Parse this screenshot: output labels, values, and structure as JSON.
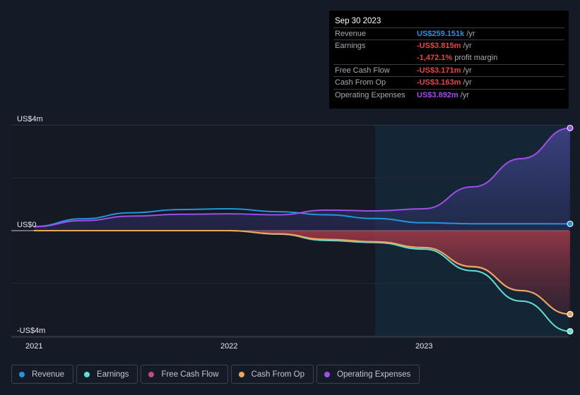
{
  "tooltip": {
    "date": "Sep 30 2023",
    "rows": [
      {
        "label": "Revenue",
        "value": "US$259.151k",
        "unit": "/yr",
        "color": "#2394df"
      },
      {
        "label": "Earnings",
        "value": "-US$3.815m",
        "unit": "/yr",
        "color": "#e64646"
      },
      {
        "label": "",
        "value": "-1,472.1%",
        "unit": "profit margin",
        "color": "#e64646"
      },
      {
        "label": "Free Cash Flow",
        "value": "-US$3.171m",
        "unit": "/yr",
        "color": "#e64646"
      },
      {
        "label": "Cash From Op",
        "value": "-US$3.163m",
        "unit": "/yr",
        "color": "#e64646"
      },
      {
        "label": "Operating Expenses",
        "value": "US$3.892m",
        "unit": "/yr",
        "color": "#a04ee8"
      }
    ]
  },
  "chart_data": {
    "type": "line",
    "x": [
      2021.0,
      2021.25,
      2021.5,
      2021.75,
      2022.0,
      2022.25,
      2022.5,
      2022.75,
      2023.0,
      2023.25,
      2023.5,
      2023.75
    ],
    "xticks": [
      {
        "v": 2021,
        "label": "2021"
      },
      {
        "v": 2022,
        "label": "2022"
      },
      {
        "v": 2023,
        "label": "2023"
      }
    ],
    "yticks": [
      {
        "v": 4,
        "label": "US$4m"
      },
      {
        "v": 0,
        "label": "US$0"
      },
      {
        "v": -4,
        "label": "-US$4m"
      }
    ],
    "ylim": [
      -4,
      4
    ],
    "unit": "US$m",
    "highlight_from": 2022.75,
    "series": [
      {
        "name": "Revenue",
        "color": "#2394df",
        "values": [
          0.16,
          0.45,
          0.68,
          0.8,
          0.83,
          0.72,
          0.6,
          0.46,
          0.3,
          0.26,
          0.26,
          0.259
        ]
      },
      {
        "name": "Earnings",
        "color": "#5ee0d2",
        "values": [
          0.0,
          0.0,
          0.0,
          0.0,
          0.0,
          -0.13,
          -0.37,
          -0.45,
          -0.7,
          -1.52,
          -2.67,
          -3.815
        ]
      },
      {
        "name": "Free Cash Flow",
        "color": "#c44b82",
        "values": [
          0.0,
          0.0,
          0.0,
          0.0,
          0.0,
          -0.12,
          -0.33,
          -0.42,
          -0.64,
          -1.38,
          -2.28,
          -3.171
        ]
      },
      {
        "name": "Cash From Op",
        "color": "#e8a95c",
        "values": [
          0.0,
          0.0,
          0.0,
          0.0,
          0.0,
          -0.12,
          -0.33,
          -0.42,
          -0.64,
          -1.36,
          -2.27,
          -3.163
        ]
      },
      {
        "name": "Operating Expenses",
        "color": "#a04ee8",
        "values": [
          0.15,
          0.38,
          0.55,
          0.62,
          0.64,
          0.6,
          0.78,
          0.75,
          0.83,
          1.66,
          2.73,
          3.892
        ]
      }
    ]
  }
}
